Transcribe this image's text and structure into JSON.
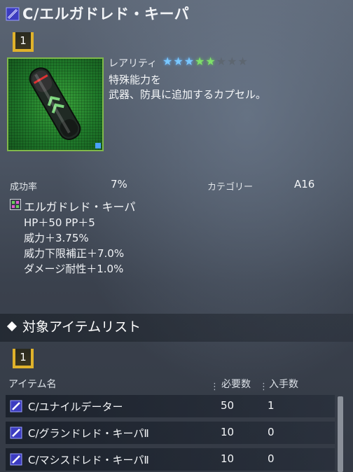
{
  "title": "C/エルガドレド・キーパ",
  "badge_top": "1",
  "rarity": {
    "label": "レアリティ",
    "filled_stars": 5,
    "total_stars": 8
  },
  "description": [
    "特殊能力を",
    "武器、防具に追加するカプセル。"
  ],
  "stats": {
    "success_label": "成功率",
    "success_value": "7%",
    "category_label": "カテゴリー",
    "category_value": "A16"
  },
  "ability": {
    "name": "エルガドレド・キーパ",
    "effects": [
      "HP＋50 PP＋5",
      "威力＋3.75%",
      "威力下限補正＋7.0%",
      "ダメージ耐性＋1.0%"
    ]
  },
  "section_title": "対象アイテムリスト",
  "badge_list": "1",
  "table": {
    "col_item": "アイテム名",
    "col_required": "必要数",
    "col_obtained": "入手数",
    "rows": [
      {
        "name": "C/ユナイルデーター",
        "required": "50",
        "obtained": "1"
      },
      {
        "name": "C/グランドレド・キーパⅡ",
        "required": "10",
        "obtained": "0"
      },
      {
        "name": "C/マシスドレド・キーパⅡ",
        "required": "10",
        "obtained": "0"
      }
    ]
  },
  "colors": {
    "accent_gold": "#e0b22b",
    "star_blue": "#79c8ff",
    "star_green": "#7fe06a",
    "item_bg_green": "#2a8a30"
  },
  "icons": {
    "capsule": "capsule-icon",
    "ability": "ability-icon",
    "section": "diamond-icon"
  }
}
